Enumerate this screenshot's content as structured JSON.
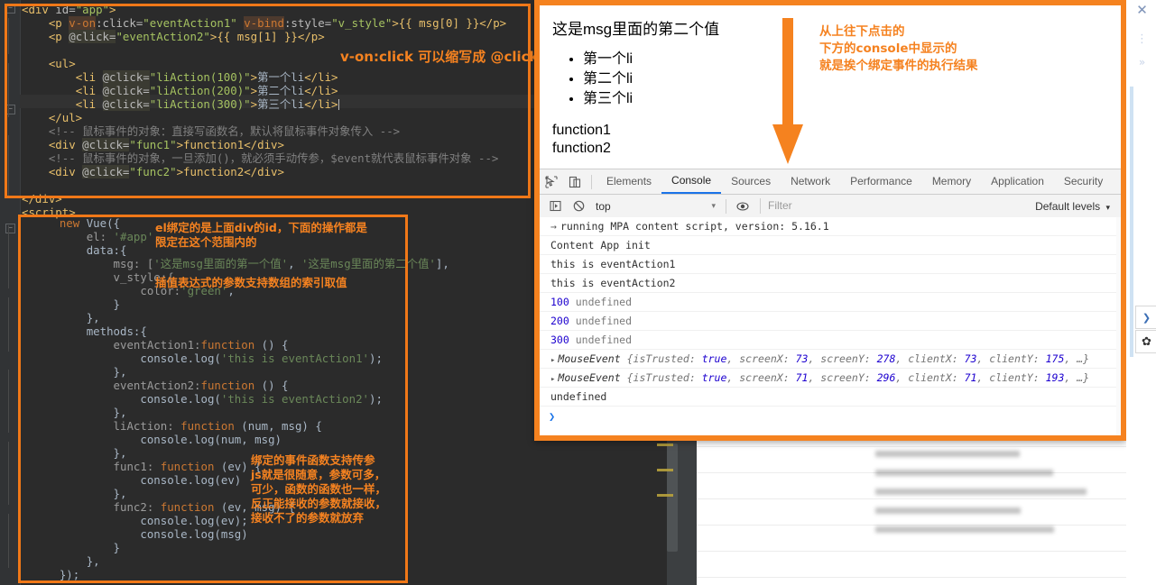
{
  "editor": {
    "language": "html-vue",
    "code_lines_top": [
      {
        "indent": 0,
        "parts": [
          {
            "t": "<div ",
            "c": "tag"
          },
          {
            "t": "id=",
            "c": "attr"
          },
          {
            "t": "\"app\"",
            "c": "str"
          },
          {
            "t": ">",
            "c": "tag"
          }
        ]
      },
      {
        "indent": 1,
        "parts": [
          {
            "t": "<p ",
            "c": "tag"
          },
          {
            "t": "v-on",
            "c": "dirhl"
          },
          {
            "t": ":click=",
            "c": "attr"
          },
          {
            "t": "\"eventAction1\"",
            "c": "str"
          },
          {
            "t": " ",
            "c": "plain"
          },
          {
            "t": "v-bind",
            "c": "dirhl"
          },
          {
            "t": ":style=",
            "c": "attr"
          },
          {
            "t": "\"v_style\"",
            "c": "str"
          },
          {
            "t": ">{{ msg[0] }}</p>",
            "c": "tag"
          }
        ]
      },
      {
        "indent": 1,
        "parts": [
          {
            "t": "<p ",
            "c": "tag"
          },
          {
            "t": "@click=",
            "c": "attrhl"
          },
          {
            "t": "\"eventAction2\"",
            "c": "str"
          },
          {
            "t": ">{{ msg[1] }}</p>",
            "c": "tag"
          }
        ]
      },
      {
        "indent": 0,
        "parts": []
      },
      {
        "indent": 1,
        "parts": [
          {
            "t": "<ul>",
            "c": "tag"
          }
        ]
      },
      {
        "indent": 2,
        "parts": [
          {
            "t": "<li ",
            "c": "tag"
          },
          {
            "t": "@click=",
            "c": "attrhl"
          },
          {
            "t": "\"liAction(100)\"",
            "c": "str"
          },
          {
            "t": ">",
            "c": "tag"
          },
          {
            "t": "第一个li",
            "c": "txtzh"
          },
          {
            "t": "</li>",
            "c": "tag"
          }
        ]
      },
      {
        "indent": 2,
        "parts": [
          {
            "t": "<li ",
            "c": "tag"
          },
          {
            "t": "@click=",
            "c": "attrhl"
          },
          {
            "t": "\"liAction(200)\"",
            "c": "str"
          },
          {
            "t": ">",
            "c": "tag"
          },
          {
            "t": "第二个li",
            "c": "txtzh"
          },
          {
            "t": "</li>",
            "c": "tag"
          }
        ]
      },
      {
        "indent": 2,
        "parts": [
          {
            "t": "<li ",
            "c": "tag"
          },
          {
            "t": "@click=",
            "c": "attrhl"
          },
          {
            "t": "\"liAction(300)\"",
            "c": "str"
          },
          {
            "t": ">",
            "c": "tag"
          },
          {
            "t": "第三个li",
            "c": "txtzh"
          },
          {
            "t": "</li>",
            "c": "tag"
          }
        ]
      },
      {
        "indent": 1,
        "parts": [
          {
            "t": "</ul>",
            "c": "tag"
          }
        ]
      },
      {
        "indent": 1,
        "parts": [
          {
            "t": "<!-- 鼠标事件的对象：直接写函数名，默认将鼠标事件对象传入 -->",
            "c": "cmt"
          }
        ]
      },
      {
        "indent": 1,
        "parts": [
          {
            "t": "<div ",
            "c": "tag"
          },
          {
            "t": "@click=",
            "c": "attrhl"
          },
          {
            "t": "\"func1\"",
            "c": "str"
          },
          {
            "t": ">function1</div>",
            "c": "tag"
          }
        ]
      },
      {
        "indent": 1,
        "parts": [
          {
            "t": "<!-- 鼠标事件的对象，一旦添加()，就必须手动传参，$event就代表鼠标事件对象 -->",
            "c": "cmt"
          }
        ]
      },
      {
        "indent": 1,
        "parts": [
          {
            "t": "<div ",
            "c": "tag"
          },
          {
            "t": "@click=",
            "c": "attrhl"
          },
          {
            "t": "\"func2\"",
            "c": "str"
          },
          {
            "t": ">function2</div>",
            "c": "tag"
          }
        ]
      },
      {
        "indent": 0,
        "parts": []
      },
      {
        "indent": 0,
        "parts": [
          {
            "t": "</div>",
            "c": "tag"
          }
        ]
      },
      {
        "indent": 0,
        "parts": [
          {
            "t": "<script>",
            "c": "tag"
          }
        ]
      }
    ],
    "code_lines_bottom": [
      {
        "indent": 1,
        "parts": [
          {
            "t": "new ",
            "c": "kw"
          },
          {
            "t": "Vue",
            "c": "plain"
          },
          {
            "t": "({",
            "c": "plain"
          }
        ]
      },
      {
        "indent": 2,
        "parts": [
          {
            "t": "el: ",
            "c": "methodname"
          },
          {
            "t": "'#app'",
            "c": "greenstr"
          },
          {
            "t": ",",
            "c": "plain"
          }
        ]
      },
      {
        "indent": 2,
        "parts": [
          {
            "t": "data:{",
            "c": "plain"
          }
        ]
      },
      {
        "indent": 3,
        "parts": [
          {
            "t": "msg: [",
            "c": "methodname"
          },
          {
            "t": "'这是msg里面的第一个值'",
            "c": "greenstr"
          },
          {
            "t": ", ",
            "c": "plain"
          },
          {
            "t": "'这是msg里面的第二个值'",
            "c": "greenstr"
          },
          {
            "t": "],",
            "c": "plain"
          }
        ]
      },
      {
        "indent": 3,
        "parts": [
          {
            "t": "v_style:{",
            "c": "methodname"
          }
        ]
      },
      {
        "indent": 4,
        "parts": [
          {
            "t": "color:",
            "c": "methodname"
          },
          {
            "t": "'green'",
            "c": "greenstr"
          },
          {
            "t": ",",
            "c": "plain"
          }
        ]
      },
      {
        "indent": 3,
        "parts": [
          {
            "t": "}",
            "c": "plain"
          }
        ]
      },
      {
        "indent": 2,
        "parts": [
          {
            "t": "},",
            "c": "plain"
          }
        ]
      },
      {
        "indent": 2,
        "parts": [
          {
            "t": "methods:{",
            "c": "plain"
          }
        ]
      },
      {
        "indent": 3,
        "parts": [
          {
            "t": "eventAction1:",
            "c": "methodname"
          },
          {
            "t": "function ",
            "c": "kw"
          },
          {
            "t": "() {",
            "c": "plain"
          }
        ]
      },
      {
        "indent": 4,
        "parts": [
          {
            "t": "console.log(",
            "c": "plain"
          },
          {
            "t": "'this is eventAction1'",
            "c": "greenstr"
          },
          {
            "t": ");",
            "c": "plain"
          }
        ]
      },
      {
        "indent": 3,
        "parts": [
          {
            "t": "},",
            "c": "plain"
          }
        ]
      },
      {
        "indent": 3,
        "parts": [
          {
            "t": "eventAction2:",
            "c": "methodname"
          },
          {
            "t": "function ",
            "c": "kw"
          },
          {
            "t": "() {",
            "c": "plain"
          }
        ]
      },
      {
        "indent": 4,
        "parts": [
          {
            "t": "console.log(",
            "c": "plain"
          },
          {
            "t": "'this is eventAction2'",
            "c": "greenstr"
          },
          {
            "t": ");",
            "c": "plain"
          }
        ]
      },
      {
        "indent": 3,
        "parts": [
          {
            "t": "},",
            "c": "plain"
          }
        ]
      },
      {
        "indent": 3,
        "parts": [
          {
            "t": "liAction: ",
            "c": "methodname"
          },
          {
            "t": "function ",
            "c": "kw"
          },
          {
            "t": "(num, msg) {",
            "c": "plain"
          }
        ]
      },
      {
        "indent": 4,
        "parts": [
          {
            "t": "console.log(num, msg)",
            "c": "plain"
          }
        ]
      },
      {
        "indent": 3,
        "parts": [
          {
            "t": "},",
            "c": "plain"
          }
        ]
      },
      {
        "indent": 3,
        "parts": [
          {
            "t": "func1: ",
            "c": "methodname"
          },
          {
            "t": "function ",
            "c": "kw"
          },
          {
            "t": "(ev) {",
            "c": "plain"
          }
        ]
      },
      {
        "indent": 4,
        "parts": [
          {
            "t": "console.log(ev)",
            "c": "plain"
          }
        ]
      },
      {
        "indent": 3,
        "parts": [
          {
            "t": "},",
            "c": "plain"
          }
        ]
      },
      {
        "indent": 3,
        "parts": [
          {
            "t": "func2: ",
            "c": "methodname"
          },
          {
            "t": "function ",
            "c": "kw"
          },
          {
            "t": "(ev, msg) {",
            "c": "plain"
          }
        ]
      },
      {
        "indent": 4,
        "parts": [
          {
            "t": "console.log(ev);",
            "c": "plain"
          }
        ]
      },
      {
        "indent": 4,
        "parts": [
          {
            "t": "console.log(msg)",
            "c": "plain"
          }
        ]
      },
      {
        "indent": 3,
        "parts": [
          {
            "t": "}",
            "c": "plain"
          }
        ]
      },
      {
        "indent": 2,
        "parts": [
          {
            "t": "},",
            "c": "plain"
          }
        ]
      },
      {
        "indent": 1,
        "parts": [
          {
            "t": "});",
            "c": "plain"
          }
        ]
      }
    ]
  },
  "annotations": {
    "accent_color": "#f5821f",
    "code_note_1": "v-on:click 可以缩写成 @click",
    "code_note_2_line1": "el绑定的是上面div的id，下面的操作都是",
    "code_note_2_line2": "限定在这个范围内的",
    "code_note_3": "插值表达式的参数支持数组的索引取值",
    "code_note_4_lines": [
      "绑定的事件函数支持传参",
      "js就是很随意，参数可多，",
      "可少，函数的函数也一样，",
      "反正能接收的参数就接收，",
      "接收不了的参数就放弃"
    ],
    "browser_note_lines": [
      "从上往下点击的",
      "下方的console中显示的",
      "就是挨个绑定事件的执行结果"
    ]
  },
  "browser_page": {
    "heading": "这是msg里面的第二个值",
    "list_items": [
      "第一个li",
      "第二个li",
      "第三个li"
    ],
    "div_texts": [
      "function1",
      "function2"
    ]
  },
  "devtools": {
    "left_icons": [
      {
        "name": "inspect-element-icon",
        "glyph": "⌖"
      },
      {
        "name": "device-toolbar-icon",
        "glyph": "▭"
      }
    ],
    "tabs": [
      {
        "label": "Elements",
        "active": false
      },
      {
        "label": "Console",
        "active": true
      },
      {
        "label": "Sources",
        "active": false
      },
      {
        "label": "Network",
        "active": false
      },
      {
        "label": "Performance",
        "active": false
      },
      {
        "label": "Memory",
        "active": false
      },
      {
        "label": "Application",
        "active": false
      },
      {
        "label": "Security",
        "active": false
      }
    ],
    "toolbar": {
      "sidebar_toggle": "▶|",
      "clear_label": "⃠",
      "context_value": "top",
      "context_caret": "▾",
      "eye_icon": "◉",
      "filter_placeholder": "Filter",
      "levels_label": "Default levels",
      "levels_caret": "▾"
    },
    "log_rows": [
      {
        "type": "plain",
        "prefix": "→",
        "text": "running MPA content script, version: 5.16.1"
      },
      {
        "type": "plain",
        "prefix": "",
        "text": "Content App init"
      },
      {
        "type": "plain",
        "prefix": "",
        "text": "this is eventAction1"
      },
      {
        "type": "plain",
        "prefix": "",
        "text": "this is eventAction2"
      },
      {
        "type": "numpair",
        "num": "100",
        "rest": "undefined"
      },
      {
        "type": "numpair",
        "num": "200",
        "rest": "undefined"
      },
      {
        "type": "numpair",
        "num": "300",
        "rest": "undefined"
      },
      {
        "type": "event",
        "disc": "▸",
        "name": "MouseEvent",
        "open": "{isTrusted: ",
        "v1": "true",
        "k2": ", screenX: ",
        "v2": "73",
        "k3": ", screenY: ",
        "v3": "278",
        "k4": ", clientX: ",
        "v4": "73",
        "k5": ", clientY: ",
        "v5": "175",
        "close": ", …}"
      },
      {
        "type": "event",
        "disc": "▸",
        "name": "MouseEvent",
        "open": "{isTrusted: ",
        "v1": "true",
        "k2": ", screenX: ",
        "v2": "71",
        "k3": ", screenY: ",
        "v3": "296",
        "k4": ", clientX: ",
        "v4": "71",
        "k5": ", clientY: ",
        "v5": "193",
        "close": ", …}"
      },
      {
        "type": "plain",
        "prefix": "",
        "text": "undefined"
      }
    ],
    "prompt": "❯"
  },
  "right_strip": {
    "close_icon": "✕",
    "more_icon": "⋮",
    "expand_icon": "»",
    "chevron_icon": "❯",
    "gear_icon": "✿"
  }
}
